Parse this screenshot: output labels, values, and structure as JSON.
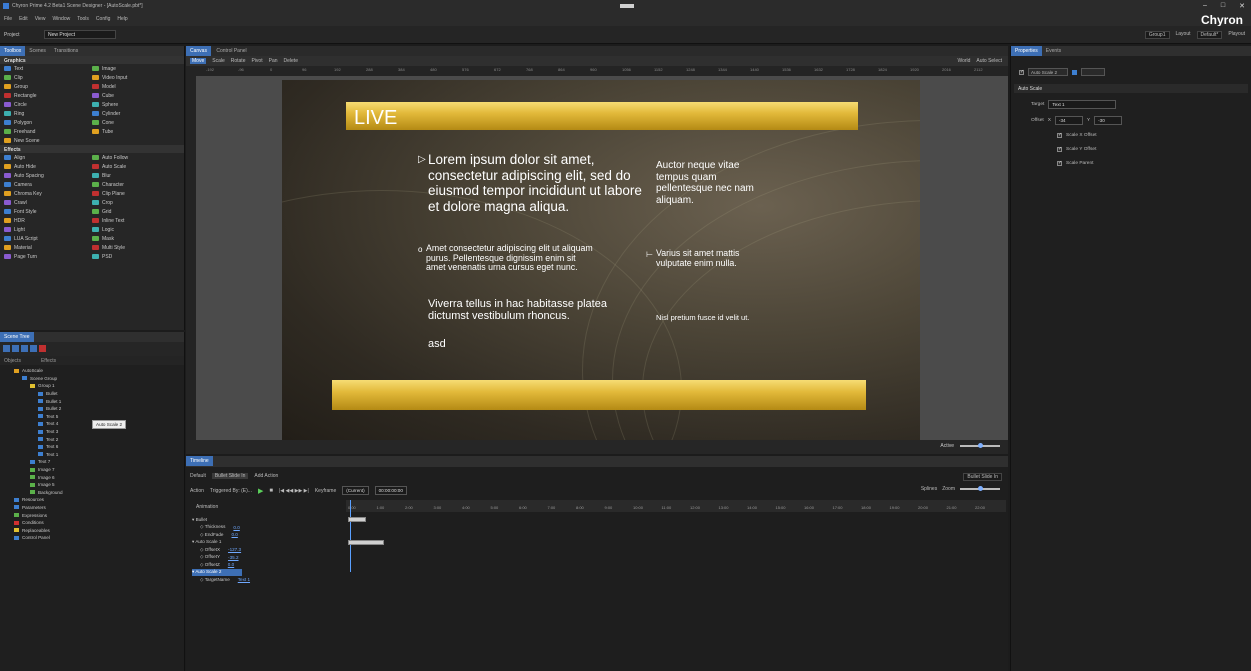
{
  "window": {
    "title": "Chyron Prime 4.2 Beta1 Scene Designer - [AutoScale.pbt*]",
    "controls": [
      "–",
      "□",
      "✕"
    ]
  },
  "menu": [
    "File",
    "Edit",
    "View",
    "Window",
    "Tools",
    "Config",
    "Help"
  ],
  "brand": "Chyron",
  "project_bar": {
    "project_label": "Project",
    "project_value": "New Project",
    "right_items": [
      "Group1",
      "Layout",
      "Default*",
      "Playout"
    ]
  },
  "toolbox": {
    "tabs": [
      "Toolbox",
      "Scenes",
      "Transitions"
    ],
    "graphics_header": "Graphics",
    "graphics": [
      [
        "Text",
        "Image"
      ],
      [
        "Clip",
        "Video Input"
      ],
      [
        "Group",
        "Model"
      ],
      [
        "Rectangle",
        "Cube"
      ],
      [
        "Circle",
        "Sphere"
      ],
      [
        "Ring",
        "Cylinder"
      ],
      [
        "Polygon",
        "Cone"
      ],
      [
        "Freehand",
        "Tube"
      ],
      [
        "New Scene",
        ""
      ]
    ],
    "effects_header": "Effects",
    "effects": [
      [
        "Align",
        "Auto Follow"
      ],
      [
        "Auto Hide",
        "Auto Scale"
      ],
      [
        "Auto Spacing",
        "Blur"
      ],
      [
        "Camera",
        "Character"
      ],
      [
        "Chroma Key",
        "Clip Plane"
      ],
      [
        "Crawl",
        "Crop"
      ],
      [
        "Font Style",
        "Grid"
      ],
      [
        "HDR",
        "Inline Text"
      ],
      [
        "Light",
        "Logic"
      ],
      [
        "LUA Script",
        "Mask"
      ],
      [
        "Material",
        "Multi Style"
      ],
      [
        "Page Turn",
        "PSD"
      ]
    ]
  },
  "scene_tree": {
    "tab": "Scene Tree",
    "columns": [
      "Objects",
      "Effects"
    ],
    "nodes": [
      {
        "label": "AutoScale",
        "indent": 1,
        "color": "#e0a020"
      },
      {
        "label": "Scene Group",
        "indent": 2,
        "color": "#3d7fd0"
      },
      {
        "label": "Group 1",
        "indent": 3,
        "color": "#e0c030"
      },
      {
        "label": "Bullet",
        "indent": 4,
        "color": "#3d7fd0"
      },
      {
        "label": "Bullet 1",
        "indent": 4,
        "color": "#3d7fd0"
      },
      {
        "label": "Bullet 2",
        "indent": 4,
        "color": "#3d7fd0"
      },
      {
        "label": "Text 5",
        "indent": 4,
        "color": "#3d7fd0"
      },
      {
        "label": "Text 4",
        "indent": 4,
        "color": "#3d7fd0"
      },
      {
        "label": "Text 3",
        "indent": 4,
        "color": "#3d7fd0"
      },
      {
        "label": "Text 2",
        "indent": 4,
        "color": "#3d7fd0"
      },
      {
        "label": "Text 6",
        "indent": 4,
        "color": "#3d7fd0"
      },
      {
        "label": "Text 1",
        "indent": 4,
        "color": "#3d7fd0"
      },
      {
        "label": "Text 7",
        "indent": 3,
        "color": "#3d7fd0"
      },
      {
        "label": "Image 7",
        "indent": 3,
        "color": "#5bb04a"
      },
      {
        "label": "Image 6",
        "indent": 3,
        "color": "#5bb04a"
      },
      {
        "label": "Image 5",
        "indent": 3,
        "color": "#5bb04a"
      },
      {
        "label": "Background",
        "indent": 3,
        "color": "#5bb04a"
      },
      {
        "label": "Resources",
        "indent": 1,
        "color": "#3d7fd0"
      },
      {
        "label": "Parameters",
        "indent": 1,
        "color": "#3d7fd0"
      },
      {
        "label": "Expressions",
        "indent": 1,
        "color": "#5bb04a"
      },
      {
        "label": "Conditions",
        "indent": 1,
        "color": "#d03030"
      },
      {
        "label": "Replaceables",
        "indent": 1,
        "color": "#e0c030"
      },
      {
        "label": "Control Panel",
        "indent": 1,
        "color": "#3d7fd0"
      }
    ],
    "tooltip": "Auto Scale 2"
  },
  "canvas": {
    "tabs": [
      "Canvas",
      "Control Panel"
    ],
    "tools": [
      "Move",
      "Scale",
      "Rotate",
      "Pivot",
      "Pan",
      "Delete"
    ],
    "right_tools": [
      "World",
      "Auto Select"
    ],
    "ruler_ticks": [
      "-192",
      "-96",
      "0",
      "96",
      "192",
      "288",
      "384",
      "480",
      "576",
      "672",
      "768",
      "864",
      "960",
      "1056",
      "1152",
      "1248",
      "1344",
      "1440",
      "1536",
      "1632",
      "1728",
      "1824",
      "1920",
      "2016",
      "2112"
    ],
    "status_right": "Active",
    "scene": {
      "live": "LIVE",
      "block1": "Lorem ipsum dolor sit amet, consectetur adipiscing elit, sed do eiusmod tempor incididunt ut labore et dolore magna aliqua.",
      "block2": "Auctor neque vitae tempus quam pellentesque nec nam aliquam.",
      "block3": "Amet consectetur adipiscing elit ut aliquam purus. Pellentesque dignissim enim sit amet venenatis urna cursus eget nunc.",
      "block4": "Varius sit amet mattis vulputate enim nulla.",
      "block5": "Viverra tellus in hac habitasse platea dictumst vestibulum rhoncus.",
      "block5b": "asd",
      "block6": "Nisl pretium fusce id velit ut.",
      "bullet1": "▷",
      "bullet2": "o",
      "bullet3": "⊢"
    }
  },
  "timeline": {
    "tab": "Timeline",
    "tabs": [
      "Default",
      "Bullet Slide In",
      "Add Action"
    ],
    "right_select": "Bullet Slide In",
    "action_label": "Action",
    "triggered": "Triggered By: (E)...",
    "keyframe_label": "Keyframe",
    "keyframe_value": "(Current)",
    "time": "00:00:00:00",
    "splines": "Splines",
    "zoom": "Zoom",
    "animation_label": "Animation",
    "ruler": [
      "0:00",
      "1:00",
      "2:00",
      "3:00",
      "4:00",
      "5:00",
      "6:00",
      "7:00",
      "8:00",
      "9:00",
      "10:00",
      "11:00",
      "12:00",
      "13:00",
      "14:00",
      "15:00",
      "16:00",
      "17:00",
      "18:00",
      "19:00",
      "20:00",
      "21:00",
      "22:00"
    ],
    "rows": [
      {
        "label": "Bullet",
        "value": "",
        "indent": 0
      },
      {
        "label": "Thickness",
        "value": "0.0",
        "indent": 2
      },
      {
        "label": "EndFade",
        "value": "0.0",
        "indent": 2
      },
      {
        "label": "Auto Scale 1",
        "value": "",
        "indent": 0
      },
      {
        "label": "OffsetX",
        "value": "-127.3",
        "indent": 2
      },
      {
        "label": "OffsetY",
        "value": "-35.2",
        "indent": 2
      },
      {
        "label": "OffsetZ",
        "value": "0.0",
        "indent": 2
      },
      {
        "label": "Auto Scale 2",
        "value": "",
        "indent": 0
      },
      {
        "label": "TargetName",
        "value": "Text 1",
        "indent": 2
      }
    ]
  },
  "properties": {
    "tabs": [
      "Properties",
      "Events"
    ],
    "name": "Auto Scale 2",
    "group": "Auto Scale",
    "target_label": "Target",
    "target_value": "Text 1",
    "offset_label": "Offset",
    "x_label": "X",
    "x_value": "-34",
    "y_label": "Y",
    "y_value": "-30",
    "checks": [
      "Scale X Offset",
      "Scale Y Offset",
      "Scale Parent"
    ]
  }
}
